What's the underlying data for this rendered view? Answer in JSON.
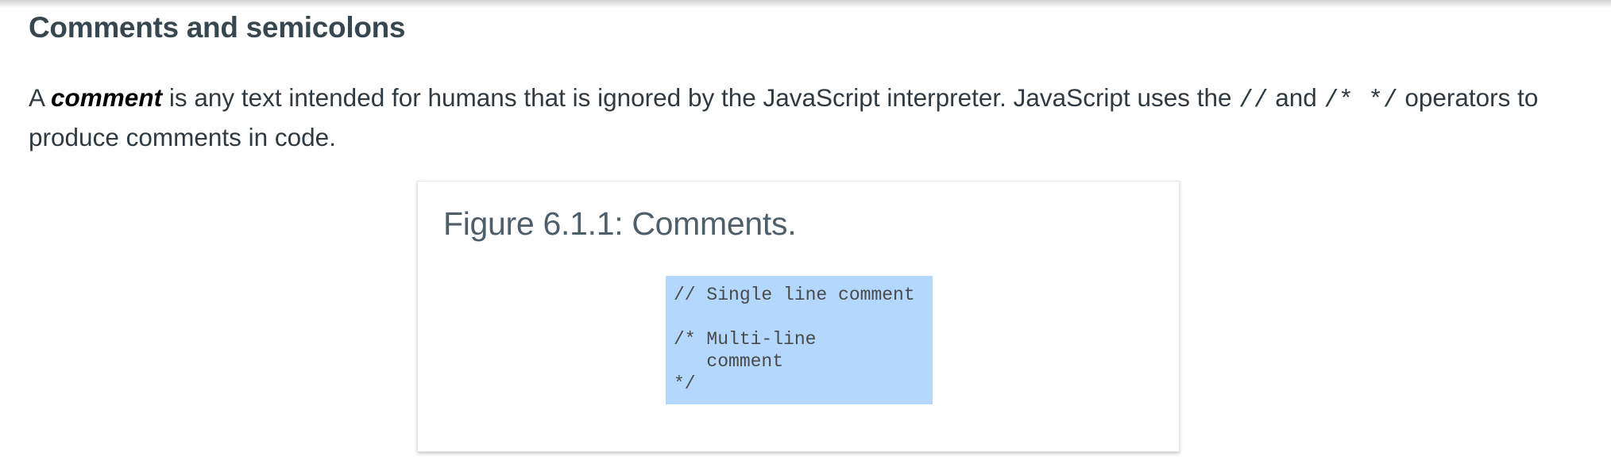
{
  "section": {
    "heading": "Comments and semicolons"
  },
  "paragraph": {
    "part1": "A ",
    "term": "comment",
    "part2": " is any text intended for humans that is ignored by the JavaScript interpreter. JavaScript uses the ",
    "op1": "//",
    "part3": " and ",
    "op2": "/* */",
    "part4": " operators to produce comments in code."
  },
  "figure": {
    "caption": "Figure 6.1.1: Comments.",
    "code": "// Single line comment\n\n/* Multi-line\n   comment\n*/",
    "highlight_color": "#b3d7fd"
  }
}
